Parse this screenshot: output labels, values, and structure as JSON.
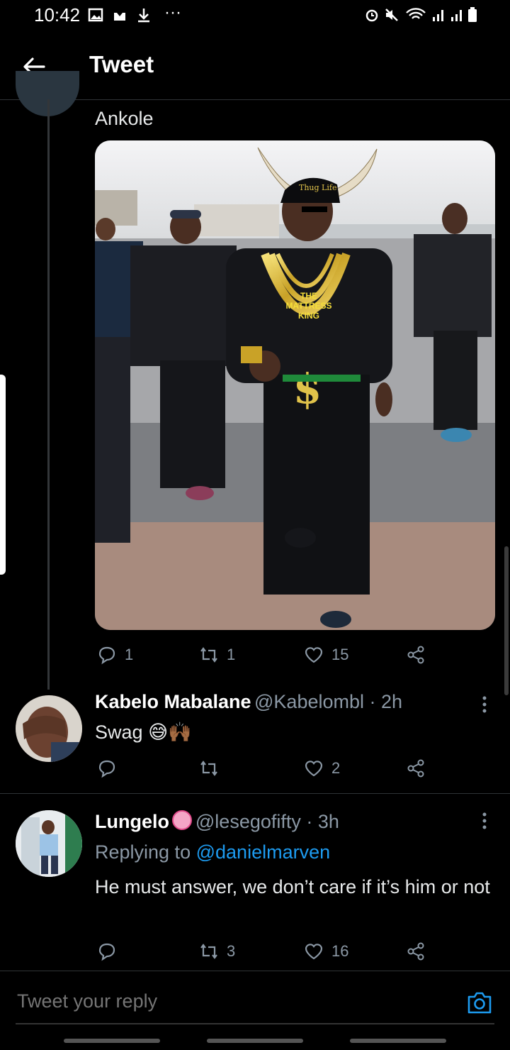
{
  "status_bar": {
    "time": "10:42"
  },
  "header": {
    "title": "Tweet"
  },
  "thread": {
    "tweet_text": "Ankole",
    "photo_labels": {
      "cap": "Thug Life",
      "shirt": "THE MATTRESS KING"
    },
    "actions": {
      "reply": "1",
      "retweet": "1",
      "like": "15"
    }
  },
  "replies": [
    {
      "name": "Kabelo Mabalane",
      "handle": "@Kabelombl · 2h",
      "text": "Swag",
      "emoji": "😅🙌🏾",
      "actions": {
        "reply": "",
        "retweet": "",
        "like": "2"
      }
    },
    {
      "name": "Lungelo",
      "handle": "@lesegofifty · 3h",
      "replying_prefix": "Replying to",
      "replying_to": "@danielmarven",
      "text": "He must answer, we don’t care if it’s him or not",
      "actions": {
        "reply": "",
        "retweet": "3",
        "like": "16"
      }
    }
  ],
  "composer": {
    "placeholder": "Tweet your reply"
  },
  "colors": {
    "accent": "#1d9bf0",
    "muted": "#8b98a5",
    "background": "#000000",
    "divider": "#2f3336"
  }
}
